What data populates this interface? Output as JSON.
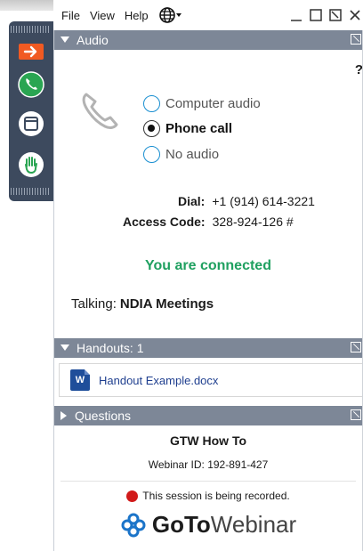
{
  "menubar": {
    "items": [
      "File",
      "View",
      "Help"
    ],
    "language_icon": "globe-icon"
  },
  "grabber": {
    "buttons": [
      {
        "name": "arrow-right-icon",
        "color": "#f15a22"
      },
      {
        "name": "phone-icon",
        "color": "#2aa552"
      },
      {
        "name": "window-icon",
        "color": "#ffffff"
      },
      {
        "name": "raise-hand-icon",
        "color": "#2aa552"
      }
    ]
  },
  "audio": {
    "header": "Audio",
    "help": "?",
    "options": [
      {
        "label": "Computer audio",
        "selected": false
      },
      {
        "label": "Phone call",
        "selected": true
      },
      {
        "label": "No audio",
        "selected": false
      }
    ],
    "dial_label": "Dial:",
    "dial_value": "+1 (914) 614-3221",
    "access_label": "Access Code:",
    "access_value": "328-924-126 #",
    "status": "You are connected",
    "talking_label": "Talking:",
    "talking_name": "NDIA Meetings"
  },
  "handouts": {
    "header": "Handouts: 1",
    "file_icon_letter": "W",
    "file_name": "Handout Example.docx"
  },
  "questions": {
    "header": "Questions",
    "webinar_title": "GTW How To",
    "webinar_id": "Webinar ID: 192-891-427",
    "recording_notice": "This session is being recorded.",
    "brand_part1": "GoTo",
    "brand_part2": "Webinar"
  },
  "colors": {
    "section_bar": "#7d8797",
    "connected": "#1fa060",
    "accent_orange": "#f15a22",
    "accent_green": "#2aa552",
    "grabber": "#3d4a5e"
  }
}
